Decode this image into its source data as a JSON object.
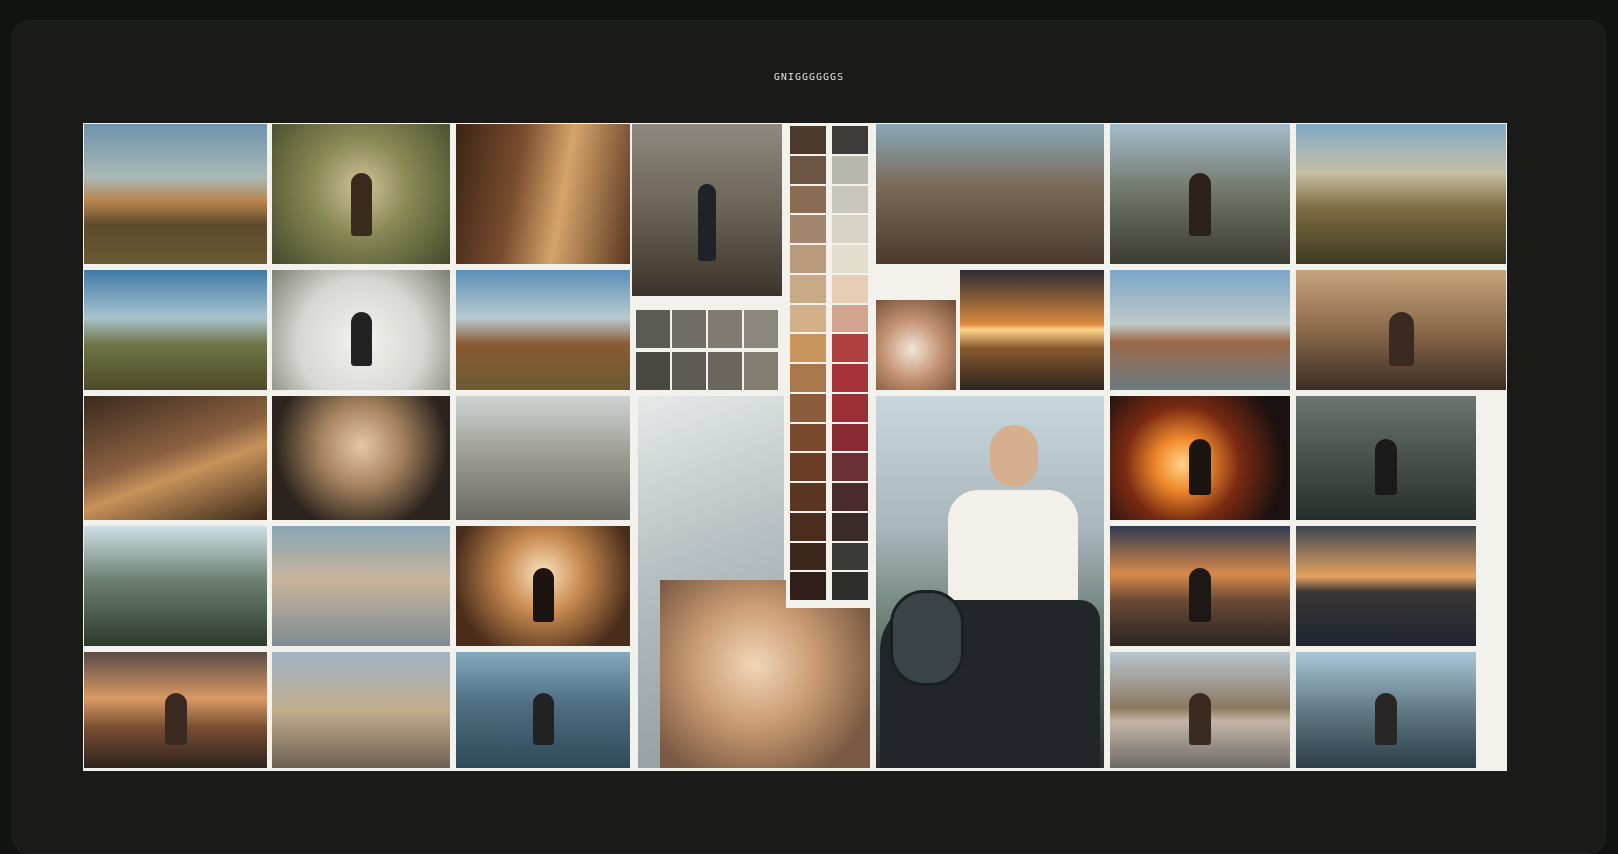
{
  "board": {
    "title": "GNIGGGGGGS"
  },
  "tiles": [
    {
      "name": "tile-mountain-meadow",
      "bg": "linear-gradient(180deg,#6f93ad 0%,#a9b8b4 38%,#b98450 55%,#5c4a2c 72%,#6b5a33 100%)",
      "fig": ""
    },
    {
      "name": "tile-cloaked-figure-forest",
      "bg": "radial-gradient(circle at 50% 45%,#d2c39a 0%,#8a8a55 40%,#45492c 100%)",
      "fig": "#3a2a1e"
    },
    {
      "name": "tile-canyon-sunlight",
      "bg": "linear-gradient(100deg,#3b2416 0%,#7a4d2e 35%,#d6a46a 60%,#5a3621 100%)",
      "fig": ""
    },
    {
      "name": "tile-figures-wasteland",
      "bg": "linear-gradient(180deg,#8e8a80 0%,#6b6355 50%,#3c342a 100%)",
      "fig": "#1f2226"
    },
    {
      "name": "tile-valley-sky",
      "bg": "linear-gradient(180deg,#3f7aa6 0%,#a9c3cf 40%,#6f7445 62%,#4e4a2a 100%)",
      "fig": ""
    },
    {
      "name": "tile-snow-figure",
      "bg": "radial-gradient(circle at 50% 60%,#f3f3f1 0%,#d6d6d2 55%,#7c8072 100%)",
      "fig": "#222"
    },
    {
      "name": "tile-rock-formation",
      "bg": "linear-gradient(180deg,#5c8fb8 0%,#b7cbd2 40%,#8a5a32 62%,#6a5a32 100%)",
      "fig": ""
    },
    {
      "name": "tile-cave-rocks",
      "bg": "linear-gradient(160deg,#3a2a1e 0%,#8a6040 45%,#c8925a 60%,#3a281a 100%)",
      "fig": ""
    },
    {
      "name": "tile-smiling-woman",
      "bg": "radial-gradient(circle at 50% 40%,#e4c7a6 0%,#a6835f 35%,#2b231d 75%)",
      "fig": ""
    },
    {
      "name": "tile-stone-spiral",
      "bg": "linear-gradient(180deg,#cfd3d2 0%,#9a9a92 50%,#6b6a62 100%)",
      "fig": ""
    },
    {
      "name": "tile-forest-road",
      "bg": "linear-gradient(180deg,#cfe0e6 0%,#6c8070 45%,#2d3a2e 100%)",
      "fig": ""
    },
    {
      "name": "tile-statue-woman",
      "bg": "linear-gradient(180deg,#88a6b6 0%,#c8b49a 45%,#7f8c93 100%)",
      "fig": ""
    },
    {
      "name": "tile-glowing-silhouette",
      "bg": "radial-gradient(circle at 50% 40%,#fbe3be 0%,#c88a50 35%,#4a2c1a 80%)",
      "fig": "#1c1410"
    },
    {
      "name": "tile-robed-figure-sunset",
      "bg": "linear-gradient(180deg,#5b4b48 0%,#d99a64 40%,#7a4e33 65%,#2d231d 100%)",
      "fig": "#3b2a22"
    },
    {
      "name": "tile-robed-group",
      "bg": "linear-gradient(180deg,#9eb4c4 0%,#c4ad8e 50%,#6e6152 100%)",
      "fig": ""
    },
    {
      "name": "tile-lake-mountains",
      "bg": "linear-gradient(180deg,#84a9be 0%,#4e6e82 45%,#2e4a5a 100%)",
      "fig": "#222"
    },
    {
      "name": "tile-rusted-truck",
      "bg": "linear-gradient(180deg,#89a9b8 0%,#7a6a56 45%,#4b3a2c 100%)",
      "fig": ""
    },
    {
      "name": "tile-figure-road",
      "bg": "linear-gradient(180deg,#a4bccb 0%,#6f7466 50%,#3a3b32 100%)",
      "fig": "#2a211b"
    },
    {
      "name": "tile-pine-desert",
      "bg": "linear-gradient(180deg,#80a9c6 0%,#c6bfa2 35%,#7f6c43 60%,#3f3a22 100%)",
      "fig": ""
    },
    {
      "name": "tile-shells-closeup",
      "bg": "radial-gradient(circle at 45% 55%,#f1e6d8 0%,#c49272 45%,#6b4a34 100%)",
      "fig": ""
    },
    {
      "name": "tile-sunset-reflection",
      "bg": "linear-gradient(180deg,#2d2a32 0%,#d98a3e 45%,#ffd38a 50%,#8a5a2e 65%,#2a2420 100%)",
      "fig": ""
    },
    {
      "name": "tile-boulder-lake",
      "bg": "linear-gradient(180deg,#79a6c8 0%,#bfc9c9 45%,#9b6848 60%,#6c7a7f 100%)",
      "fig": ""
    },
    {
      "name": "tile-figures-dust",
      "bg": "linear-gradient(180deg,#c7a47a 0%,#8b6a4c 50%,#3d2d22 100%)",
      "fig": "#3a2a20"
    },
    {
      "name": "tile-fire-explosion",
      "bg": "radial-gradient(circle at 40% 55%,#ffd489 0%,#f08a2c 20%,#7a2a12 45%,#1b1110 80%)",
      "fig": "#1b1410"
    },
    {
      "name": "tile-misty-forest",
      "bg": "linear-gradient(180deg,#6c7570 0%,#4a514d 50%,#26302a 100%)",
      "fig": "#1a1a1a"
    },
    {
      "name": "tile-sunset-wanderer",
      "bg": "linear-gradient(180deg,#2f3b52 0%,#d88a4b 40%,#6b4a35 62%,#2a2523 100%)",
      "fig": "#1d1815"
    },
    {
      "name": "tile-dusk-shore",
      "bg": "linear-gradient(180deg,#3b4652 0%,#e4a160 42%,#3b3635 55%,#1e2530 100%)",
      "fig": ""
    },
    {
      "name": "tile-beach-horizon",
      "bg": "linear-gradient(180deg,#b8c6cf 0%,#8a7860 48%,#c3b6a6 60%,#6d6a66 100%)",
      "fig": "#3a2a20"
    },
    {
      "name": "tile-ruins-figure",
      "bg": "linear-gradient(180deg,#a9c6d8 0%,#617a86 50%,#2c3e48 100%)",
      "fig": "#2a2626"
    }
  ],
  "palette_left": [
    "#5b5b55",
    "#6f6d65",
    "#7f7b70",
    "#8c877c",
    "#4a4843",
    "#5c5952",
    "#6a665d",
    "#817b70"
  ],
  "palette_strip_a": [
    "#4a3a2c",
    "#6d5543",
    "#8a6c55",
    "#a2856c",
    "#b99a7c",
    "#c9aa88",
    "#d4b08a",
    "#c8955e",
    "#a8774c",
    "#8a5c3b",
    "#7a4a2e",
    "#6a3e26",
    "#5a3622",
    "#4b2d1f",
    "#3d261b",
    "#302019"
  ],
  "palette_strip_b": [
    "#3c3b37",
    "#b8b7ad",
    "#c9c6bb",
    "#d6d2c4",
    "#e3ddcc",
    "#e8cdb5",
    "#d2a38e",
    "#b04040",
    "#a8323a",
    "#9a2f36",
    "#8a2a32",
    "#6a3034",
    "#4a2a2c",
    "#3a2a2a",
    "#3a3a38",
    "#2d2d2b"
  ]
}
